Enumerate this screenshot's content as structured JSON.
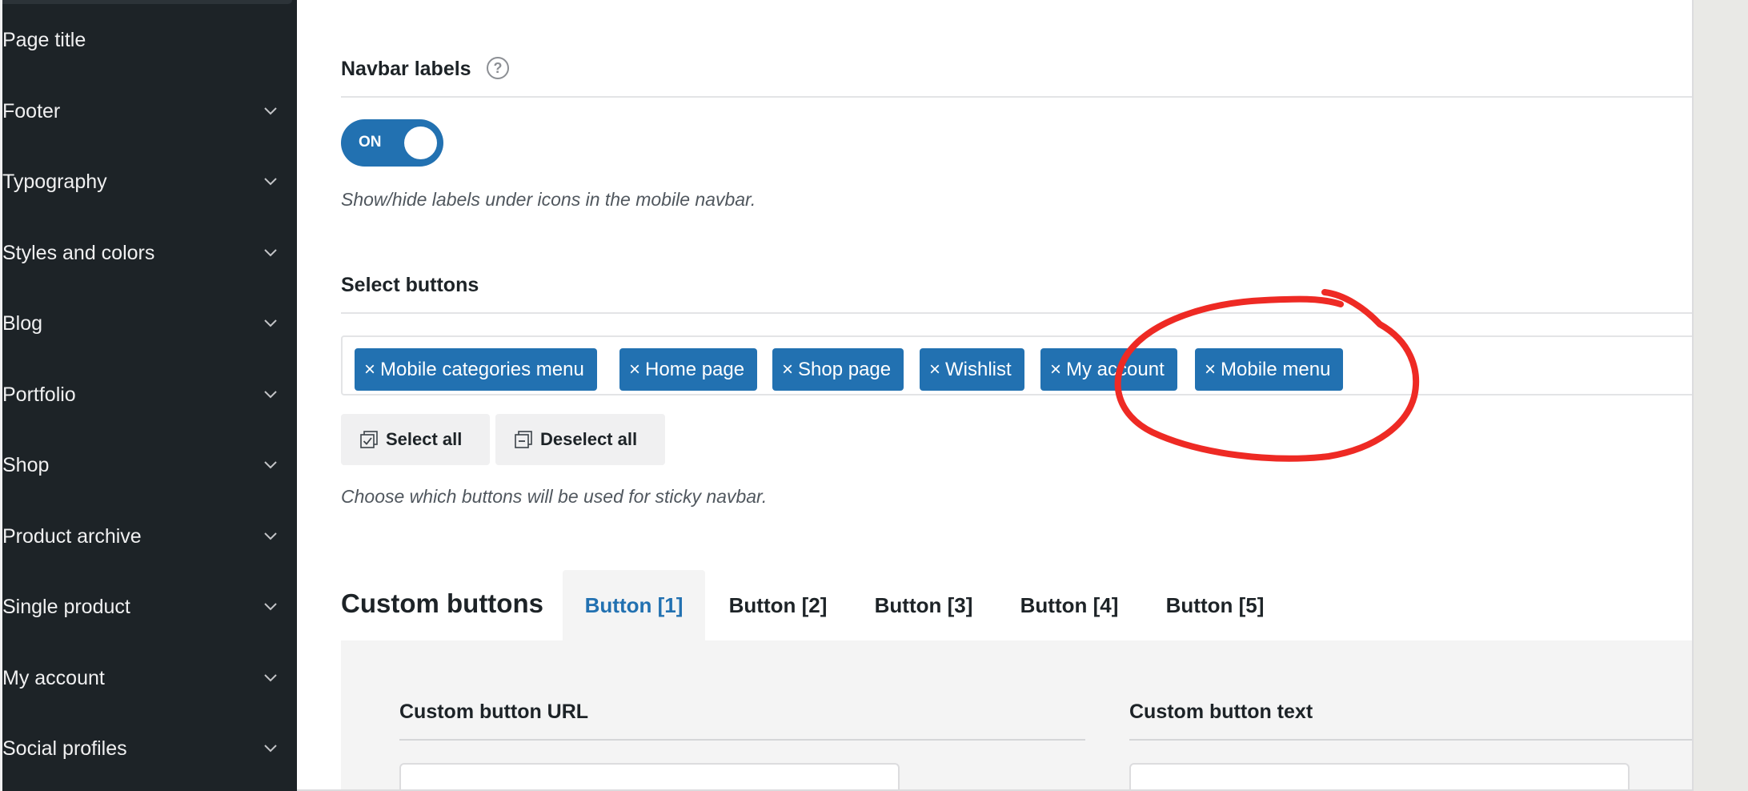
{
  "sidebar": {
    "items": [
      {
        "label": "Page title",
        "has_chevron": false
      },
      {
        "label": "Footer",
        "has_chevron": true
      },
      {
        "label": "Typography",
        "has_chevron": true
      },
      {
        "label": "Styles and colors",
        "has_chevron": true
      },
      {
        "label": "Blog",
        "has_chevron": true
      },
      {
        "label": "Portfolio",
        "has_chevron": true
      },
      {
        "label": "Shop",
        "has_chevron": true
      },
      {
        "label": "Product archive",
        "has_chevron": true
      },
      {
        "label": "Single product",
        "has_chevron": true
      },
      {
        "label": "My account",
        "has_chevron": true
      },
      {
        "label": "Social profiles",
        "has_chevron": true
      }
    ]
  },
  "navbar_labels": {
    "title": "Navbar labels",
    "help_icon": "question-circle-icon",
    "toggle_text": "ON",
    "toggle_state": "on",
    "description": "Show/hide labels under icons in the mobile navbar."
  },
  "select_buttons": {
    "title": "Select buttons",
    "tag_remove_symbol": "×",
    "tags": [
      "Mobile categories menu",
      "Home page",
      "Shop page",
      "Wishlist",
      "My account",
      "Mobile menu"
    ],
    "select_all_label": "Select all",
    "deselect_all_label": "Deselect all",
    "description": "Choose which buttons will be used for sticky navbar."
  },
  "custom_buttons": {
    "title": "Custom buttons",
    "tabs": [
      "Button [1]",
      "Button [2]",
      "Button [3]",
      "Button [4]",
      "Button [5]"
    ],
    "active_tab": "Button [1]",
    "url_label": "Custom button URL",
    "text_label": "Custom button text"
  },
  "colors": {
    "sidebar_bg": "#1d2327",
    "accent": "#2271b1",
    "annotation": "#ee2a24"
  }
}
